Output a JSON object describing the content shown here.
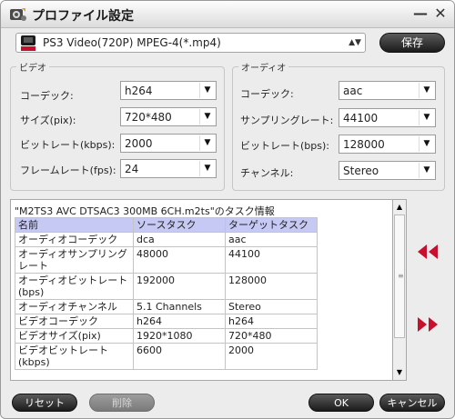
{
  "window": {
    "title": "プロファイル設定",
    "minimize_glyph": "—",
    "close_glyph": "✕"
  },
  "profile": {
    "selected": "PS3 Video(720P) MPEG-4(*.mp4)",
    "icon": "ps3-video-icon",
    "save_label": "保存"
  },
  "video": {
    "legend": "ビデオ",
    "fields": [
      {
        "label": "コーデック:",
        "value": "h264"
      },
      {
        "label": "サイズ(pix):",
        "value": "720*480"
      },
      {
        "label": "ビットレート(kbps):",
        "value": "2000"
      },
      {
        "label": "フレームレート(fps):",
        "value": "24"
      }
    ]
  },
  "audio": {
    "legend": "オーディオ",
    "fields": [
      {
        "label": "コーデック:",
        "value": "aac"
      },
      {
        "label": "サンプリングレート:",
        "value": "44100"
      },
      {
        "label": "ビットレート(bps):",
        "value": "128000"
      },
      {
        "label": "チャンネル:",
        "value": "Stereo"
      }
    ]
  },
  "info": {
    "caption": "\"M2TS3 AVC DTSAC3 300MB 6CH.m2ts\"のタスク情報",
    "headers": [
      "名前",
      "ソースタスク",
      "ターゲットタスク"
    ],
    "rows": [
      [
        "オーディオコーデック",
        "dca",
        "aac"
      ],
      [
        "オーディオサンプリングレート",
        "48000",
        "44100"
      ],
      [
        "オーディオビットレート(bps)",
        "192000",
        "128000"
      ],
      [
        "オーディオチャンネル",
        "5.1 Channels",
        "Stereo"
      ],
      [
        "ビデオコーデック",
        "h264",
        "h264"
      ],
      [
        "ビデオサイズ(pix)",
        "1920*1080",
        "720*480"
      ],
      [
        "ビデオビットレート(kbps)",
        "6600",
        "2000"
      ]
    ]
  },
  "buttons": {
    "reset": "リセット",
    "delete": "削除",
    "ok": "OK",
    "cancel": "キャンセル"
  },
  "colors": {
    "accent_red": "#c8102e",
    "table_header": "#c5c9f4",
    "dark_button": "#1b1b1b"
  }
}
